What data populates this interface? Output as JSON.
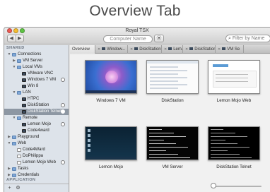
{
  "heading": "Overview Tab",
  "window": {
    "title": "Royal TSX",
    "computer_name_placeholder": "Computer Name",
    "filter_placeholder": "Filter by Name"
  },
  "sidebar": {
    "shared_label": "SHARED",
    "application_label": "APPLICATION",
    "rows": [
      {
        "label": "Connections",
        "indent": 0,
        "kind": "folder",
        "disclosure": "open",
        "selected": false,
        "status": false
      },
      {
        "label": "VM Server",
        "indent": 1,
        "kind": "folder",
        "disclosure": "closed",
        "selected": false,
        "status": false
      },
      {
        "label": "Local VMs",
        "indent": 1,
        "kind": "folder",
        "disclosure": "open",
        "selected": false,
        "status": false
      },
      {
        "label": "VMware VNC",
        "indent": 2,
        "kind": "screen",
        "disclosure": "",
        "selected": false,
        "status": false
      },
      {
        "label": "Windows 7 VM",
        "indent": 2,
        "kind": "screen",
        "disclosure": "",
        "selected": false,
        "status": true
      },
      {
        "label": "Win 8",
        "indent": 2,
        "kind": "screen",
        "disclosure": "",
        "selected": false,
        "status": false
      },
      {
        "label": "LAN",
        "indent": 1,
        "kind": "folder",
        "disclosure": "open",
        "selected": false,
        "status": false
      },
      {
        "label": "HTPC",
        "indent": 2,
        "kind": "screen",
        "disclosure": "",
        "selected": false,
        "status": false
      },
      {
        "label": "DiskStation",
        "indent": 2,
        "kind": "screen",
        "disclosure": "",
        "selected": false,
        "status": true
      },
      {
        "label": "DiskStation Telnet",
        "indent": 2,
        "kind": "screen",
        "disclosure": "",
        "selected": true,
        "status": true
      },
      {
        "label": "Remote",
        "indent": 1,
        "kind": "folder",
        "disclosure": "open",
        "selected": false,
        "status": false
      },
      {
        "label": "Lemon Mojo",
        "indent": 2,
        "kind": "screen",
        "disclosure": "",
        "selected": false,
        "status": true
      },
      {
        "label": "Code4ward",
        "indent": 2,
        "kind": "screen",
        "disclosure": "",
        "selected": false,
        "status": false
      },
      {
        "label": "Playground",
        "indent": 0,
        "kind": "folder",
        "disclosure": "closed",
        "selected": false,
        "status": false
      },
      {
        "label": "Web",
        "indent": 0,
        "kind": "folder",
        "disclosure": "open",
        "selected": false,
        "status": false
      },
      {
        "label": "Code4Ward",
        "indent": 1,
        "kind": "web",
        "disclosure": "",
        "selected": false,
        "status": false
      },
      {
        "label": "DoPhilippa",
        "indent": 1,
        "kind": "web",
        "disclosure": "",
        "selected": false,
        "status": false
      },
      {
        "label": "Lemon Mojo Web",
        "indent": 1,
        "kind": "web",
        "disclosure": "",
        "selected": false,
        "status": true
      },
      {
        "label": "Tasks",
        "indent": 0,
        "kind": "folder",
        "disclosure": "closed",
        "selected": false,
        "status": false
      },
      {
        "label": "Credentials",
        "indent": 0,
        "kind": "folder",
        "disclosure": "closed",
        "selected": false,
        "status": false
      }
    ]
  },
  "tabs": [
    {
      "label": "Overview",
      "active": true,
      "closable": false,
      "width": 36
    },
    {
      "label": "Window...",
      "active": false,
      "closable": true,
      "width": 46
    },
    {
      "label": "DiskStation",
      "active": false,
      "closable": true,
      "width": 48
    },
    {
      "label": "Lem...",
      "active": false,
      "closable": true,
      "width": 30
    },
    {
      "label": "DiskStation",
      "active": false,
      "closable": true,
      "width": 46
    },
    {
      "label": "VM Se",
      "active": false,
      "closable": true,
      "width": 40
    }
  ],
  "thumbnails": [
    {
      "caption": "Windows 7 VM",
      "style": "win7"
    },
    {
      "caption": "DiskStation",
      "style": "ds"
    },
    {
      "caption": "Lemon Mojo Web",
      "style": "lm"
    },
    {
      "caption": "Lemon Mojo",
      "style": "lmj"
    },
    {
      "caption": "VM Server",
      "style": "vms"
    },
    {
      "caption": "DiskStation Telnet",
      "style": "tel"
    }
  ]
}
